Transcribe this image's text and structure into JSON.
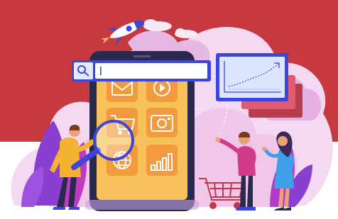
{
  "colors": {
    "banner": "#C63A3F",
    "background": "#FFFFFF",
    "cloud_light": "#F4D9F2",
    "cloud_pink": "#EFC3E8",
    "cloud_purple": "#E3A6E0",
    "phone_body": "#2A2A4E",
    "phone_screen": "#F6C15A",
    "app_tile": "#F29A3C",
    "app_icon": "#FFFFFF",
    "search_bar": "#FFFFFF",
    "search_frame": "#3C46D8",
    "chart_panel": "#DCE6FF",
    "chart_frame": "#3C46D8",
    "chart_line": "#3C46D8",
    "plant_purple": "#8A3FD0",
    "plant_magenta": "#C03AC0",
    "cart": "#C8364A",
    "person_yellow": "#F4B233",
    "person_magenta": "#D43A8A",
    "dress_blue": "#3EA0E8",
    "rocket": "#3C46D8"
  },
  "illustration": {
    "subject": "online-shopping-search-concept",
    "icons": [
      "rocket-icon",
      "search-icon",
      "mail-icon",
      "play-icon",
      "shopping-basket-icon",
      "camera-icon",
      "globe-icon",
      "bar-chart-icon",
      "line-chart-icon",
      "shopping-cart-icon",
      "magnifier-icon"
    ]
  }
}
